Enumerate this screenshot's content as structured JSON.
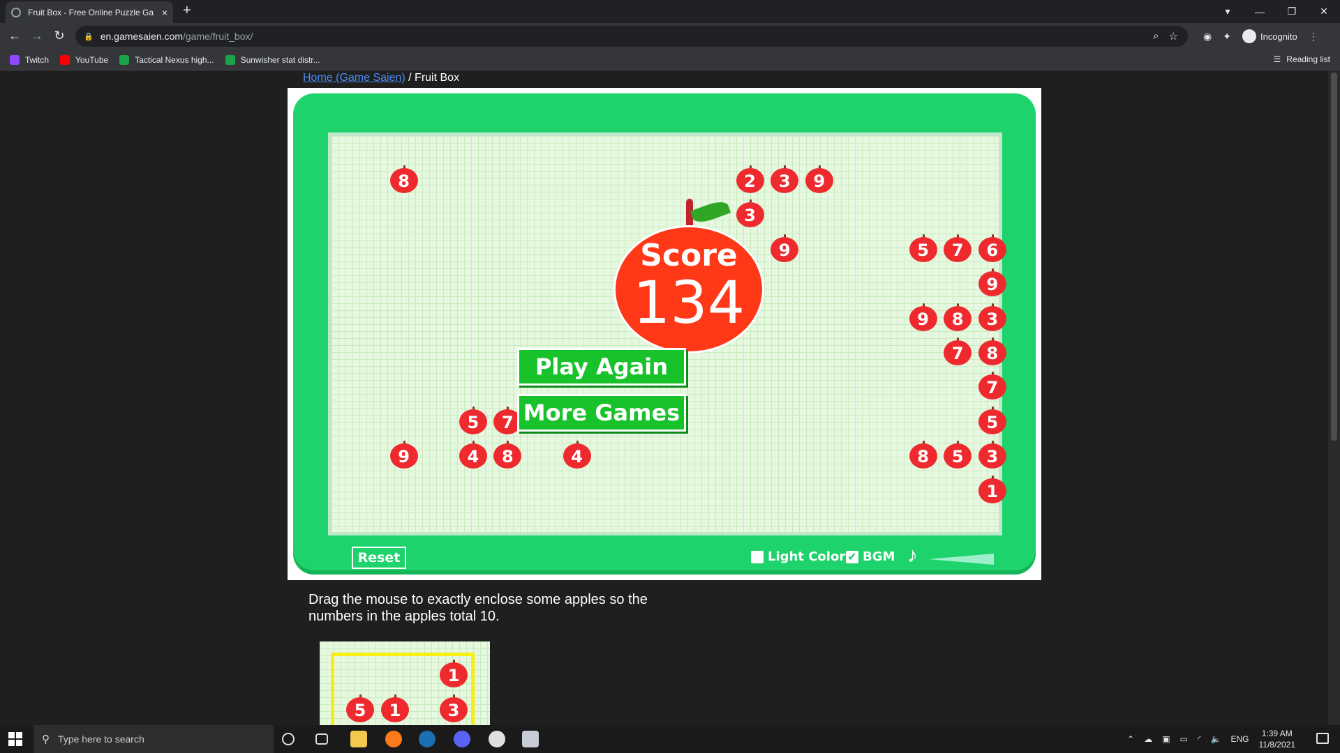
{
  "browser": {
    "tab_title": "Fruit Box - Free Online Puzzle Ga",
    "new_tab": "+",
    "close_tab": "×",
    "url_host": "en.gamesaien.com",
    "url_path": "/game/fruit_box/",
    "incognito_label": "Incognito",
    "bookmarks": [
      {
        "label": "Twitch",
        "color": "#9146ff"
      },
      {
        "label": "YouTube",
        "color": "#ff0000"
      },
      {
        "label": "Tactical Nexus high...",
        "color": "#1aa34a"
      },
      {
        "label": "Sunwisher stat distr...",
        "color": "#1aa34a"
      }
    ],
    "reading_list": "Reading list"
  },
  "page": {
    "breadcrumb_home": "Home (Game Saien)",
    "breadcrumb_sep": " / Fruit Box",
    "instructions": "Drag the mouse to exactly enclose some apples so the numbers in the apples total 10."
  },
  "game": {
    "score_label": "Score",
    "score_value": "134",
    "play_again": "Play Again",
    "more_games": "More Games",
    "reset": "Reset",
    "light_colors": "Light Colors",
    "bgm": "BGM",
    "light_colors_checked": false,
    "bgm_checked": true,
    "apples": [
      {
        "row": 0,
        "col": 1,
        "n": "8"
      },
      {
        "row": 0,
        "col": 11,
        "n": "2"
      },
      {
        "row": 0,
        "col": 12,
        "n": "3"
      },
      {
        "row": 0,
        "col": 13,
        "n": "9"
      },
      {
        "row": 1,
        "col": 11,
        "n": "3"
      },
      {
        "row": 2,
        "col": 12,
        "n": "9"
      },
      {
        "row": 2,
        "col": 16,
        "n": "5"
      },
      {
        "row": 2,
        "col": 17,
        "n": "7"
      },
      {
        "row": 2,
        "col": 18,
        "n": "6"
      },
      {
        "row": 3,
        "col": 18,
        "n": "9"
      },
      {
        "row": 4,
        "col": 16,
        "n": "9"
      },
      {
        "row": 4,
        "col": 17,
        "n": "8"
      },
      {
        "row": 4,
        "col": 18,
        "n": "3"
      },
      {
        "row": 5,
        "col": 17,
        "n": "7"
      },
      {
        "row": 5,
        "col": 18,
        "n": "8"
      },
      {
        "row": 6,
        "col": 18,
        "n": "7"
      },
      {
        "row": 7,
        "col": 3,
        "n": "5"
      },
      {
        "row": 7,
        "col": 4,
        "n": "7"
      },
      {
        "row": 7,
        "col": 18,
        "n": "5"
      },
      {
        "row": 8,
        "col": 1,
        "n": "9"
      },
      {
        "row": 8,
        "col": 3,
        "n": "4"
      },
      {
        "row": 8,
        "col": 4,
        "n": "8"
      },
      {
        "row": 8,
        "col": 6,
        "n": "4"
      },
      {
        "row": 8,
        "col": 16,
        "n": "8"
      },
      {
        "row": 8,
        "col": 17,
        "n": "5"
      },
      {
        "row": 8,
        "col": 18,
        "n": "3"
      },
      {
        "row": 9,
        "col": 18,
        "n": "1"
      }
    ],
    "demo_apples": [
      {
        "row": 0,
        "col": 0,
        "n": "1"
      },
      {
        "row": 1,
        "col": 0,
        "n": "5"
      },
      {
        "row": 1,
        "col": 1,
        "n": "1"
      },
      {
        "row": 1,
        "col": 3,
        "n": "3"
      }
    ]
  },
  "taskbar": {
    "search_placeholder": "Type here to search",
    "lang": "ENG",
    "time": "1:39 AM",
    "date": "11/8/2021"
  }
}
